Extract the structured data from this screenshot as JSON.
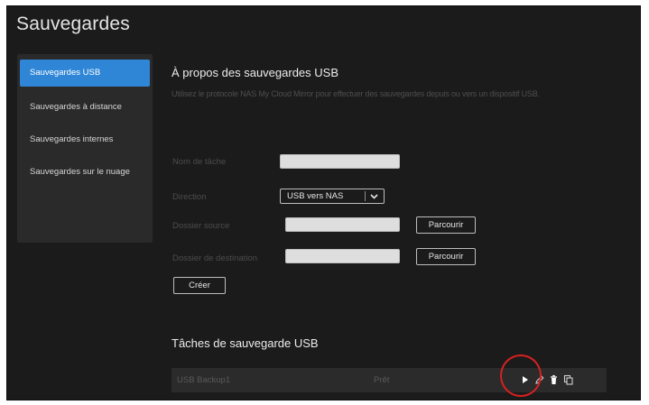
{
  "app": {
    "title": "Sauvegardes"
  },
  "sidebar": {
    "items": [
      {
        "label": "Sauvegardes USB",
        "active": true
      },
      {
        "label": "Sauvegardes à distance",
        "active": false
      },
      {
        "label": "Sauvegardes internes",
        "active": false
      },
      {
        "label": "Sauvegardes sur le nuage",
        "active": false
      }
    ]
  },
  "main": {
    "about_title": "À propos des sauvegardes USB",
    "about_desc": "Utilisez le protocole NAS My Cloud Mirror pour effectuer des sauvegardes depuis ou vers un dispositif USB.",
    "form": {
      "task_name_label": "Nom de tâche",
      "task_name_value": "",
      "direction_label": "Direction",
      "direction_value": "USB vers NAS",
      "source_label": "Dossier source",
      "source_value": "",
      "destination_label": "Dossier de destination",
      "destination_value": "",
      "browse_label": "Parcourir",
      "create_label": "Créer"
    },
    "tasks_title": "Tâches de sauvegarde USB",
    "tasks": [
      {
        "name": "USB Backup1",
        "status": "Prêt"
      }
    ]
  },
  "colors": {
    "accent": "#2f86d6",
    "background": "#1b1b1b",
    "panel": "#2a2a2a",
    "highlight": "#d62020"
  },
  "icons": {
    "run": "play-icon",
    "edit": "edit-icon",
    "delete": "trash-icon",
    "copy": "copy-icon",
    "dropdown": "chevron-down-icon"
  }
}
